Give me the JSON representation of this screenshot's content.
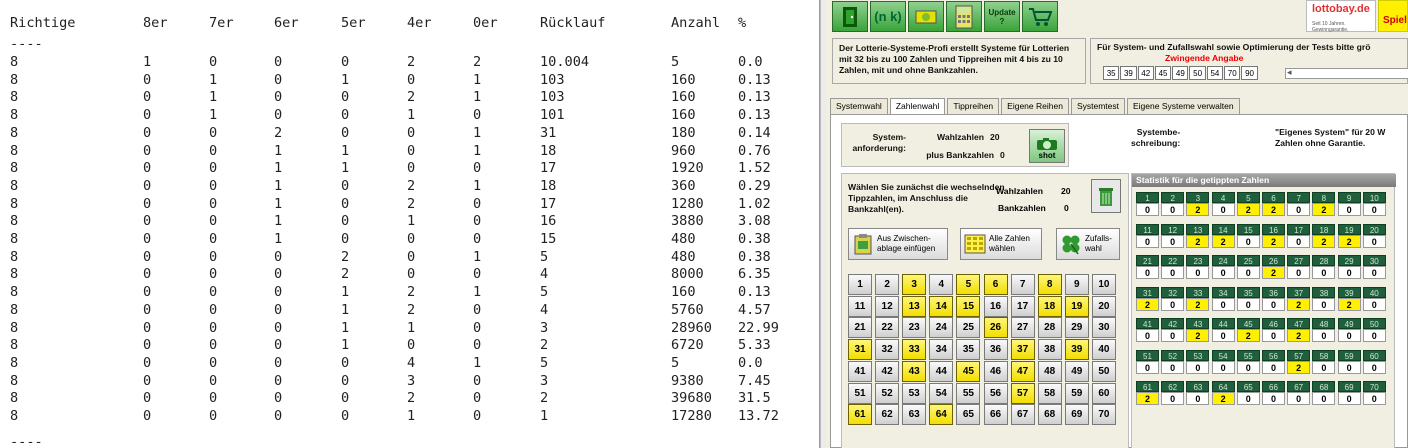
{
  "left": {
    "headers": [
      "Richtige",
      "8er",
      "7er",
      "6er",
      "5er",
      "4er",
      "0er",
      "Rücklauf",
      "Anzahl",
      "%"
    ],
    "dash_top": "----",
    "dash_bottom": "----",
    "rows": [
      [
        "8",
        "1",
        "0",
        "0",
        "0",
        "2",
        "2",
        "10.004",
        "5",
        "0.0"
      ],
      [
        "8",
        "0",
        "1",
        "0",
        "1",
        "0",
        "1",
        "103",
        "160",
        "0.13"
      ],
      [
        "8",
        "0",
        "1",
        "0",
        "0",
        "2",
        "1",
        "103",
        "160",
        "0.13"
      ],
      [
        "8",
        "0",
        "1",
        "0",
        "0",
        "1",
        "0",
        "101",
        "160",
        "0.13"
      ],
      [
        "8",
        "0",
        "0",
        "2",
        "0",
        "0",
        "1",
        "31",
        "180",
        "0.14"
      ],
      [
        "8",
        "0",
        "0",
        "1",
        "1",
        "0",
        "1",
        "18",
        "960",
        "0.76"
      ],
      [
        "8",
        "0",
        "0",
        "1",
        "1",
        "0",
        "0",
        "17",
        "1920",
        "1.52"
      ],
      [
        "8",
        "0",
        "0",
        "1",
        "0",
        "2",
        "1",
        "18",
        "360",
        "0.29"
      ],
      [
        "8",
        "0",
        "0",
        "1",
        "0",
        "2",
        "0",
        "17",
        "1280",
        "1.02"
      ],
      [
        "8",
        "0",
        "0",
        "1",
        "0",
        "1",
        "0",
        "16",
        "3880",
        "3.08"
      ],
      [
        "8",
        "0",
        "0",
        "1",
        "0",
        "0",
        "0",
        "15",
        "480",
        "0.38"
      ],
      [
        "8",
        "0",
        "0",
        "0",
        "2",
        "0",
        "1",
        "5",
        "480",
        "0.38"
      ],
      [
        "8",
        "0",
        "0",
        "0",
        "2",
        "0",
        "0",
        "4",
        "8000",
        "6.35"
      ],
      [
        "8",
        "0",
        "0",
        "0",
        "1",
        "2",
        "1",
        "5",
        "160",
        "0.13"
      ],
      [
        "8",
        "0",
        "0",
        "0",
        "1",
        "2",
        "0",
        "4",
        "5760",
        "4.57"
      ],
      [
        "8",
        "0",
        "0",
        "0",
        "1",
        "1",
        "0",
        "3",
        "28960",
        "22.99"
      ],
      [
        "8",
        "0",
        "0",
        "0",
        "1",
        "0",
        "0",
        "2",
        "6720",
        "5.33"
      ],
      [
        "8",
        "0",
        "0",
        "0",
        "0",
        "4",
        "1",
        "5",
        "5",
        "0.0"
      ],
      [
        "8",
        "0",
        "0",
        "0",
        "0",
        "3",
        "0",
        "3",
        "9380",
        "7.45"
      ],
      [
        "8",
        "0",
        "0",
        "0",
        "0",
        "2",
        "0",
        "2",
        "39680",
        "31.5"
      ],
      [
        "8",
        "0",
        "0",
        "0",
        "0",
        "1",
        "0",
        "1",
        "17280",
        "13.72"
      ]
    ]
  },
  "toolbar": {
    "buttons": [
      "door-icon",
      "nk-icon",
      "money-icon",
      "calculator-icon",
      "update-icon",
      "cart-icon"
    ],
    "nk_label": "(n k)",
    "update_label": "Update ?",
    "logo_text": "lottobay.de",
    "logo_sub": "Seit 10 Jahren. Gewinngarantie.",
    "logo2_text": "Spiel"
  },
  "desc": {
    "text": "Der Lotterie-Systeme-Profi erstellt Systeme für Lotterien mit 32 bis zu 100 Zahlen und Tippreihen mit 4 bis zu 10 Zahlen, mit und ohne Bankzahlen."
  },
  "system_choice": {
    "title": "Für System- und Zufallswahl sowie Optimierung der Tests bitte grö",
    "required": "Zwingende Angabe",
    "numbers": [
      "35",
      "39",
      "42",
      "45",
      "49",
      "50",
      "54",
      "70",
      "90"
    ]
  },
  "tabs": [
    "Systemwahl",
    "Zahlenwahl",
    "Tippreihen",
    "Eigene Reihen",
    "Systemtest",
    "Eigene Systeme verwalten"
  ],
  "active_tab": "Zahlenwahl",
  "sysreq": {
    "label": "System- anforderung:",
    "wahl_label": "Wahlzahlen",
    "wahl_value": "20",
    "bank_label": "plus Bankzahlen",
    "bank_value": "0",
    "shot_label": "shot"
  },
  "sysbeschreibung": {
    "label1": "Systembe-",
    "label2": "schreibung:",
    "value1": "\"Eigenes System\" für 20 W",
    "value2": "Zahlen ohne Garantie."
  },
  "selection": {
    "info": "Wählen Sie zunächst die wechselnden Tippzahlen, im Anschluss die Bankzahl(en).",
    "wahl_label": "Wahlzahlen",
    "wahl_value": "20",
    "bank_label": "Bankzahlen",
    "bank_value": "0",
    "clip_label": "Aus Zwischen- ablage einfügen",
    "all_label": "Alle Zahlen wählen",
    "random_label": "Zufalls- wahl"
  },
  "numbers": {
    "selected": [
      3,
      5,
      6,
      8,
      13,
      14,
      15,
      18,
      19,
      26,
      31,
      33,
      37,
      39,
      43,
      45,
      47,
      57,
      61,
      64
    ],
    "max": 70
  },
  "stats": {
    "title": "Statistik für die getippten Zahlen",
    "values": [
      [
        0,
        0,
        2,
        0,
        2,
        2,
        0,
        2,
        0,
        0
      ],
      [
        0,
        0,
        2,
        2,
        0,
        2,
        0,
        2,
        2,
        0
      ],
      [
        0,
        0,
        0,
        0,
        0,
        2,
        0,
        0,
        0,
        0
      ],
      [
        2,
        0,
        2,
        0,
        0,
        0,
        2,
        0,
        2,
        0
      ],
      [
        0,
        0,
        2,
        0,
        2,
        0,
        2,
        0,
        0,
        0
      ],
      [
        0,
        0,
        0,
        0,
        0,
        0,
        2,
        0,
        0,
        0
      ],
      [
        2,
        0,
        0,
        2,
        0,
        0,
        0,
        0,
        0,
        0
      ]
    ]
  }
}
